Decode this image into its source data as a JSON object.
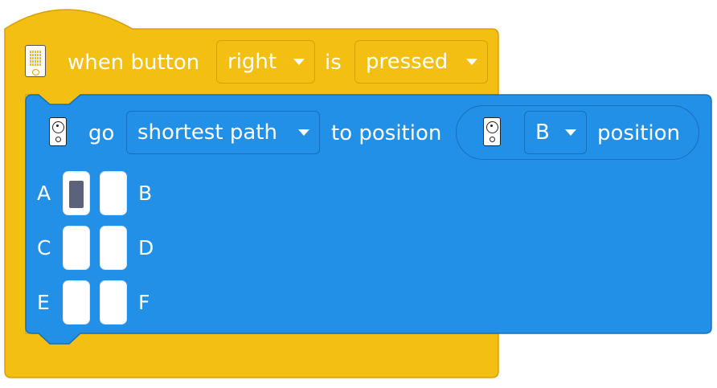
{
  "hat_block": {
    "prefix": "when button",
    "button_value": "right",
    "middle": "is",
    "state_value": "pressed",
    "color": "#f3bf12",
    "icon": "hub-light-matrix-icon"
  },
  "command_block": {
    "go_label": "go",
    "path_value": "shortest path",
    "to_position_label": "to position",
    "position_value": "B",
    "position_suffix": "position",
    "color": "#2190e6",
    "icon": "motor-controller-icon"
  },
  "position_grid": {
    "rows": [
      {
        "left": "A",
        "right": "B"
      },
      {
        "left": "C",
        "right": "D"
      },
      {
        "left": "E",
        "right": "F"
      }
    ],
    "selected": "A"
  }
}
